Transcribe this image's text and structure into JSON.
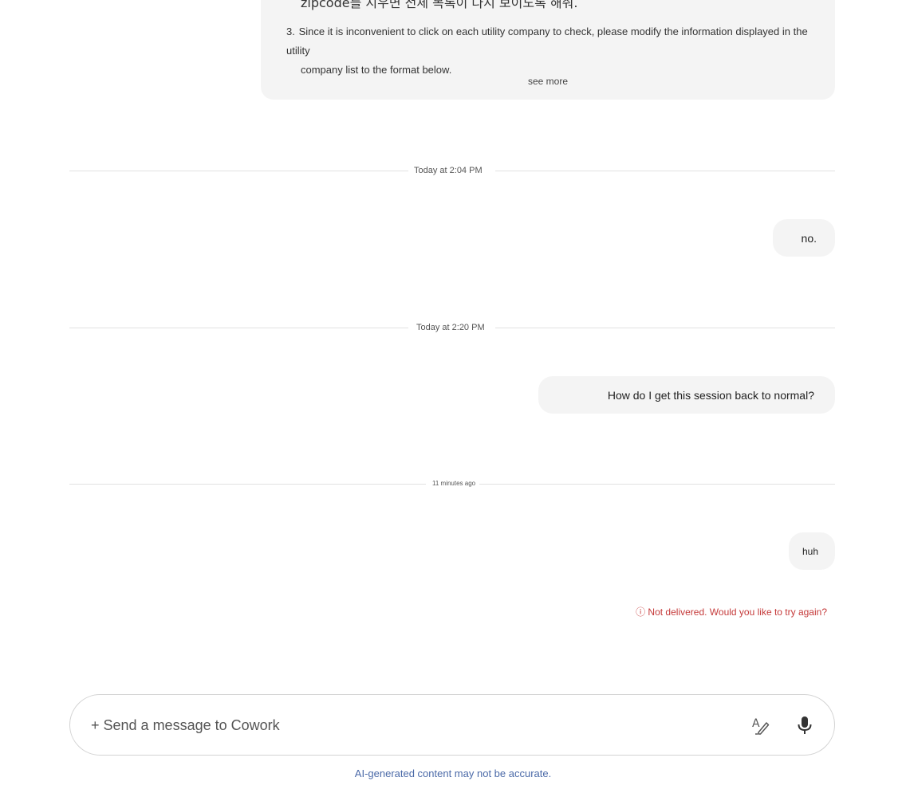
{
  "top_card": {
    "partial_line": "zipcode를 지우면 전체 목록이 다시 보이도록 해줘.",
    "item3_number": "3.",
    "item3_line1": "Since it is inconvenient to click on each utility company to check, please modify the information displayed in the utility",
    "item3_line2": "company list to the format below.",
    "see_more": "see more"
  },
  "dividers": [
    "Today at 2:04 PM",
    "Today at 2:20 PM",
    "11 minutes ago"
  ],
  "messages": [
    "no.",
    "How do I get this session back to normal?",
    "huh"
  ],
  "error_note": {
    "icon": "ⓘ",
    "text": "Not delivered. Would you like to try again?"
  },
  "composer": {
    "placeholder": "+ Send a message to Cowork",
    "icons": [
      "spellcheck-icon",
      "microphone-icon"
    ]
  },
  "disclaimer": "AI-generated content may not be accurate."
}
